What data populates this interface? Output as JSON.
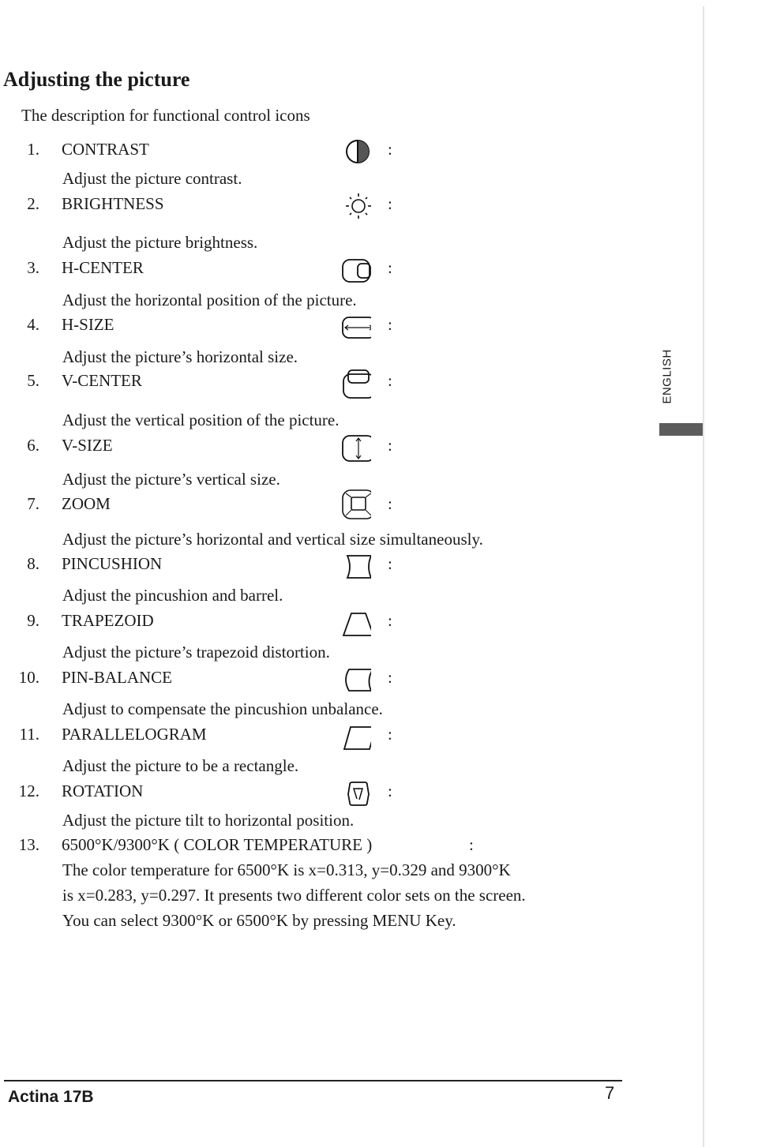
{
  "title": "Adjusting the picture",
  "intro": "The description for functional control icons",
  "colon": ":",
  "items": [
    {
      "num": "1.",
      "label": "CONTRAST",
      "icon": "contrast-icon",
      "desc": "Adjust the picture contrast."
    },
    {
      "num": "2.",
      "label": "BRIGHTNESS",
      "icon": "brightness-sun-icon",
      "desc": "Adjust the picture brightness."
    },
    {
      "num": "3.",
      "label": "H-CENTER",
      "icon": "h-center-icon",
      "desc": "Adjust the horizontal position of the picture."
    },
    {
      "num": "4.",
      "label": "H-SIZE",
      "icon": "h-size-icon",
      "desc": "Adjust the picture’s horizontal size."
    },
    {
      "num": "5.",
      "label": "V-CENTER",
      "icon": "v-center-icon",
      "desc": "Adjust the vertical position of the picture."
    },
    {
      "num": "6.",
      "label": "V-SIZE",
      "icon": "v-size-icon",
      "desc": "Adjust the picture’s vertical size."
    },
    {
      "num": "7.",
      "label": "ZOOM",
      "icon": "zoom-icon",
      "desc": "Adjust the picture’s horizontal and vertical size simultaneously."
    },
    {
      "num": "8.",
      "label": "PINCUSHION",
      "icon": "pincushion-icon",
      "desc": "Adjust the pincushion and barrel."
    },
    {
      "num": "9.",
      "label": "TRAPEZOID",
      "icon": "trapezoid-icon",
      "desc": "Adjust the picture’s trapezoid distortion."
    },
    {
      "num": "10.",
      "label": "PIN-BALANCE",
      "icon": "pin-balance-icon",
      "desc": "Adjust to compensate the pincushion unbalance."
    },
    {
      "num": "11.",
      "label": "PARALLELOGRAM",
      "icon": "parallelogram-icon",
      "desc": "Adjust the picture to be a rectangle."
    },
    {
      "num": "12.",
      "label": "ROTATION",
      "icon": "rotation-icon",
      "desc": "Adjust the picture tilt to horizontal position."
    }
  ],
  "color_temp": {
    "num": "13.",
    "label": "6500°K/9300°K ( COLOR  TEMPERATURE )",
    "lines": [
      "The color temperature for 6500°K is x=0.313,  y=0.329 and 9300°K",
      "is x=0.283, y=0.297. It presents two different color sets on the screen.",
      "You can select 9300°K or 6500°K by pressing MENU Key."
    ]
  },
  "side_label": "ENGLISH",
  "footer": {
    "brand": "Actina 17B",
    "page_number": "7"
  }
}
